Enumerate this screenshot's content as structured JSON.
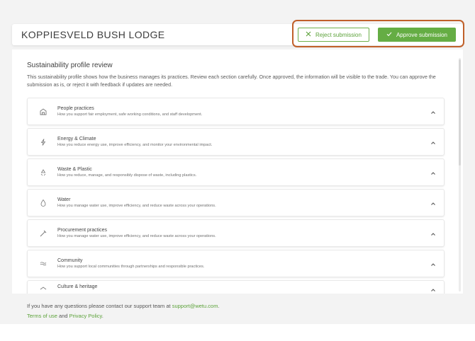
{
  "header": {
    "lodge_name": "KOPPIESVELD BUSH LODGE",
    "reject_label": "Reject submission",
    "approve_label": "Approve submission"
  },
  "review": {
    "title": "Sustainability profile review",
    "description": "This sustainability profile shows how the business manages its practices. Review each section carefully. Once approved, the information will be visible to the trade. You can approve the submission as is, or reject it with feedback if updates are needed."
  },
  "sections": [
    {
      "icon": "people-icon",
      "title": "People practices",
      "desc": "How you support fair employment, safe working conditions, and staff development."
    },
    {
      "icon": "lightning-icon",
      "title": "Energy & Climate",
      "desc": "How you reduce energy use, improve efficiency, and monitor your environmental impact."
    },
    {
      "icon": "recycle-icon",
      "title": "Waste & Plastic",
      "desc": "How you reduce, manage, and responsibly dispose of waste, including plastics."
    },
    {
      "icon": "water-drop-icon",
      "title": "Water",
      "desc": "How you manage water use, improve efficiency, and reduce waste across your operations."
    },
    {
      "icon": "procurement-icon",
      "title": "Procurement practices",
      "desc": "How you manage water use, improve efficiency, and reduce waste across your operations."
    },
    {
      "icon": "community-icon",
      "title": "Community",
      "desc": "How you support local communities through partnerships and responsible practices."
    },
    {
      "icon": "culture-icon",
      "title": "Culture & heritage",
      "desc": ""
    }
  ],
  "footer": {
    "contact_text": "If you have any questions please contact our support team at ",
    "support_email": "support@wetu.com",
    "period": ".",
    "terms_label": "Terms of use",
    "and_text": " and ",
    "privacy_label": "Privacy Policy",
    "period2": "."
  },
  "colors": {
    "accent_green": "#65ad44",
    "highlight_orange": "#c0602a"
  }
}
